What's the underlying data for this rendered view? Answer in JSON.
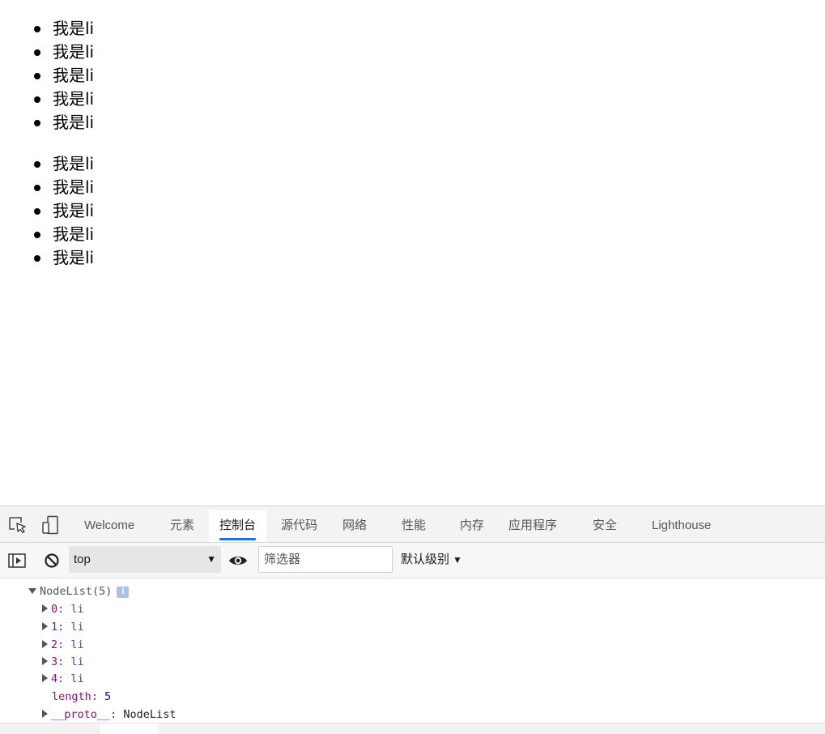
{
  "page": {
    "list1": [
      "我是li",
      "我是li",
      "我是li",
      "我是li",
      "我是li"
    ],
    "list2": [
      "我是li",
      "我是li",
      "我是li",
      "我是li",
      "我是li"
    ]
  },
  "devtools": {
    "icons": {
      "inspect": "inspect-element-icon",
      "device": "device-toolbar-icon",
      "sidebar": "console-sidebar-icon",
      "clear": "clear-console-icon",
      "eye": "live-expression-eye-icon"
    },
    "tabs": [
      "Welcome",
      "元素",
      "控制台",
      "源代码",
      "网络",
      "性能",
      "内存",
      "应用程序",
      "安全",
      "Lighthouse"
    ],
    "active_tab": "控制台",
    "toolbar": {
      "context": "top",
      "filter_placeholder": "筛选器",
      "level": "默认级别"
    },
    "console": {
      "header": "NodeList(5)",
      "info_badge": "i",
      "items": [
        {
          "key": "0",
          "value": "li"
        },
        {
          "key": "1",
          "value": "li"
        },
        {
          "key": "2",
          "value": "li"
        },
        {
          "key": "3",
          "value": "li"
        },
        {
          "key": "4",
          "value": "li"
        }
      ],
      "length_key": "length",
      "length_value": "5",
      "proto_key": "__proto__",
      "proto_value": "NodeList"
    },
    "colors": {
      "accent": "#1a73e8",
      "key_purple": "#881280",
      "value_blue": "#2a56a8"
    }
  }
}
